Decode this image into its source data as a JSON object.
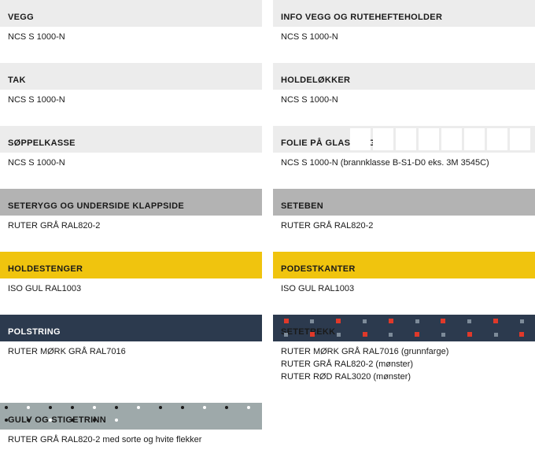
{
  "left": [
    {
      "title": "VEGG",
      "desc": "NCS S 1000-N",
      "swatch": "sw-light"
    },
    {
      "title": "TAK",
      "desc": "NCS S 1000-N",
      "swatch": "sw-light"
    },
    {
      "title": "SØPPELKASSE",
      "desc": "NCS S 1000-N",
      "swatch": "sw-light"
    },
    {
      "title": "SETERYGG OG UNDERSIDE KLAPPSIDE",
      "desc": "RUTER GRÅ RAL820-2",
      "swatch": "sw-grey"
    },
    {
      "title": "HOLDESTENGER",
      "desc": "ISO GUL RAL1003",
      "swatch": "sw-yellow"
    },
    {
      "title": "POLSTRING",
      "desc": "RUTER MØRK GRÅ RAL7016",
      "swatch": "sw-dark"
    },
    {
      "title": "GULV OG STIGETRINN",
      "desc": "RUTER GRÅ RAL820-2 med sorte og hvite flekker",
      "swatch": "sw-floor"
    }
  ],
  "right": [
    {
      "title": "INFO VEGG OG RUTEHEFTEHOLDER",
      "desc": "NCS S 1000-N",
      "swatch": "sw-light"
    },
    {
      "title": "HOLDELØKKER",
      "desc": "NCS S 1000-N",
      "swatch": "sw-light"
    },
    {
      "title": "FOLIE PÅ GLASSVEGG",
      "desc": "NCS S 1000-N (brannklasse B-S1-D0 eks. 3M 3545C)",
      "swatch": "sw-squares"
    },
    {
      "title": "SETEBEN",
      "desc": "RUTER GRÅ RAL820-2",
      "swatch": "sw-grey"
    },
    {
      "title": "PODESTKANTER",
      "desc": "ISO GUL RAL1003",
      "swatch": "sw-yellow"
    },
    {
      "title": "SETETREKK",
      "desc": "RUTER MØRK GRÅ RAL7016 (grunnfarge)\nRUTER GRÅ RAL820-2 (mønster)\nRUTER RØD RAL3020 (mønster)",
      "swatch": "sw-seat"
    }
  ]
}
